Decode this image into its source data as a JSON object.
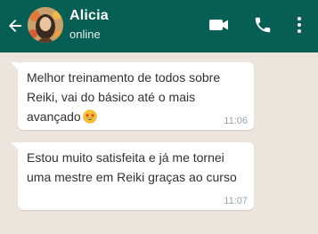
{
  "header": {
    "contact_name": "Alicia",
    "status": "online",
    "bg_color": "#075e54",
    "icons": [
      "back-arrow-icon",
      "video-call-icon",
      "phone-call-icon",
      "more-vert-icon"
    ]
  },
  "messages": [
    {
      "lines": [
        "Melhor treinamento de todos sobre",
        "Reiki, vai do básico até o mais",
        "avançado"
      ],
      "emoji": "star-struck-emoji",
      "time": "11:06"
    },
    {
      "lines": [
        "Estou muito satisfeita e já me tornei",
        "uma mestre em Reiki graças ao curso"
      ],
      "time": "11:07"
    }
  ]
}
